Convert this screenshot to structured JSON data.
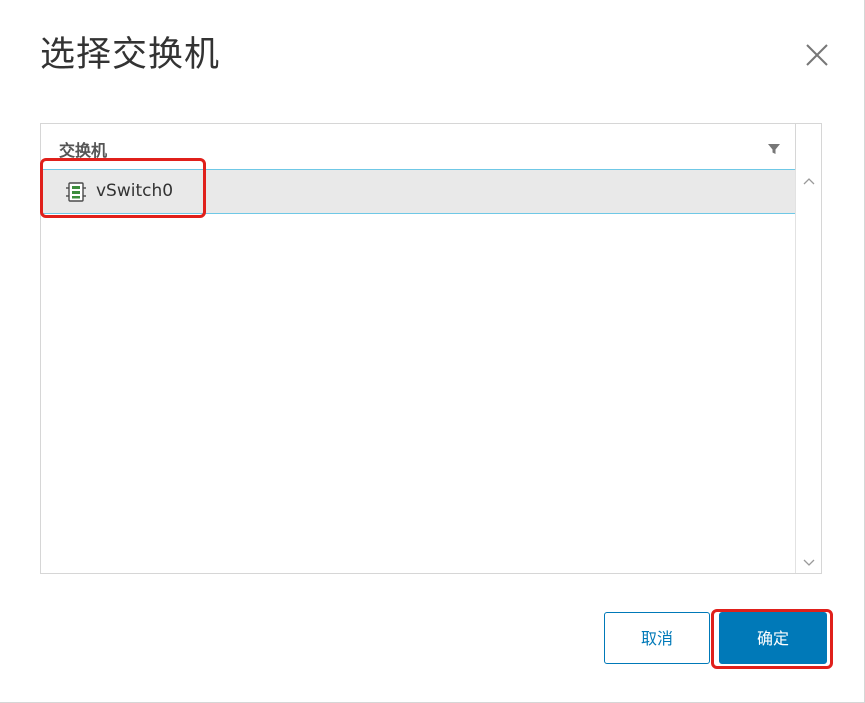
{
  "dialog": {
    "title": "选择交换机",
    "close_icon": "close-icon"
  },
  "grid": {
    "column_header": "交换机",
    "filter_icon": "filter-icon",
    "rows": [
      {
        "label": "vSwitch0",
        "icon": "virtual-switch-icon",
        "selected": true
      }
    ]
  },
  "footer": {
    "cancel_label": "取消",
    "ok_label": "确定"
  },
  "colors": {
    "accent": "#0079b8",
    "selection_border": "#6fc8e6",
    "selected_row_bg": "#e9e9e9",
    "annotation_red": "#e0201b",
    "switch_icon_green": "#3c8d3c"
  }
}
